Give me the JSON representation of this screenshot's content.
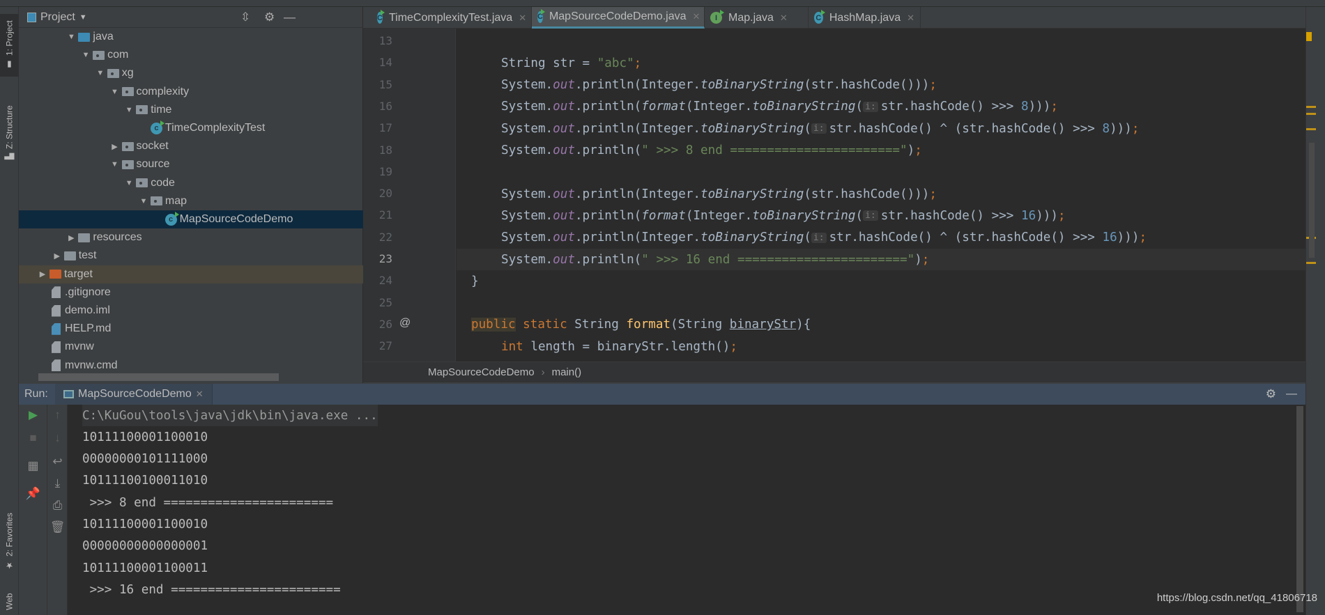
{
  "left_strip": {
    "project": "1: Project",
    "structure": "Z: Structure",
    "favorites": "2: Favorites",
    "web": "Web"
  },
  "project_panel": {
    "title": "Project",
    "tree": [
      {
        "label": "java",
        "level": 2,
        "expanded": true,
        "icon": "source-folder"
      },
      {
        "label": "com",
        "level": 3,
        "expanded": true,
        "icon": "package"
      },
      {
        "label": "xg",
        "level": 4,
        "expanded": true,
        "icon": "package"
      },
      {
        "label": "complexity",
        "level": 5,
        "expanded": true,
        "icon": "package"
      },
      {
        "label": "time",
        "level": 6,
        "expanded": true,
        "icon": "package"
      },
      {
        "label": "TimeComplexityTest",
        "level": 7,
        "icon": "java-class"
      },
      {
        "label": "socket",
        "level": 5,
        "expanded": false,
        "icon": "package"
      },
      {
        "label": "source",
        "level": 5,
        "expanded": true,
        "icon": "package"
      },
      {
        "label": "code",
        "level": 6,
        "expanded": true,
        "icon": "package"
      },
      {
        "label": "map",
        "level": 7,
        "expanded": true,
        "icon": "package"
      },
      {
        "label": "MapSourceCodeDemo",
        "level": 8,
        "icon": "java-class",
        "selected": true
      },
      {
        "label": "resources",
        "level": 2,
        "expanded": false,
        "icon": "resources-folder"
      },
      {
        "label": "test",
        "level": 1,
        "expanded": false,
        "icon": "folder"
      },
      {
        "label": "target",
        "level": 0,
        "expanded": false,
        "icon": "excluded-folder",
        "highlight": true
      },
      {
        "label": ".gitignore",
        "level": 0,
        "icon": "file"
      },
      {
        "label": "demo.iml",
        "level": 0,
        "icon": "file"
      },
      {
        "label": "HELP.md",
        "level": 0,
        "icon": "markdown-file"
      },
      {
        "label": "mvnw",
        "level": 0,
        "icon": "file"
      },
      {
        "label": "mvnw.cmd",
        "level": 0,
        "icon": "file"
      }
    ]
  },
  "editor": {
    "tabs": [
      {
        "label": "TimeComplexityTest.java",
        "icon": "C",
        "active": false
      },
      {
        "label": "MapSourceCodeDemo.java",
        "icon": "C",
        "active": true
      },
      {
        "label": "Map.java",
        "icon": "I",
        "active": false
      },
      {
        "label": "HashMap.java",
        "icon": "C",
        "active": false
      }
    ],
    "current_line": 23,
    "lines": [
      {
        "n": 13,
        "indent": 0,
        "tokens": []
      },
      {
        "n": 14,
        "indent": 2,
        "tokens": [
          [
            "String str = ",
            ""
          ],
          [
            "\"abc\"",
            "str"
          ],
          [
            ";",
            "semi"
          ]
        ]
      },
      {
        "n": 15,
        "indent": 2,
        "tokens": [
          [
            "System.",
            ""
          ],
          [
            "out",
            "field"
          ],
          [
            ".println(Integer.",
            ""
          ],
          [
            "toBinaryString",
            "static"
          ],
          [
            "(str.hashCode()))",
            ""
          ],
          [
            ";",
            "semi"
          ]
        ]
      },
      {
        "n": 16,
        "indent": 2,
        "tokens": [
          [
            "System.",
            ""
          ],
          [
            "out",
            "field"
          ],
          [
            ".println(",
            ""
          ],
          [
            "format",
            "static"
          ],
          [
            "(Integer.",
            ""
          ],
          [
            "toBinaryString",
            "static"
          ],
          [
            "(",
            ""
          ],
          [
            "i:",
            "hint"
          ],
          [
            "str.hashCode() >>> ",
            ""
          ],
          [
            "8",
            "num"
          ],
          [
            ")))",
            ""
          ],
          [
            ";",
            "semi"
          ]
        ]
      },
      {
        "n": 17,
        "indent": 2,
        "tokens": [
          [
            "System.",
            ""
          ],
          [
            "out",
            "field"
          ],
          [
            ".println(Integer.",
            ""
          ],
          [
            "toBinaryString",
            "static"
          ],
          [
            "(",
            ""
          ],
          [
            "i:",
            "hint"
          ],
          [
            "str.hashCode() ^ (str.hashCode() >>> ",
            ""
          ],
          [
            "8",
            "num"
          ],
          [
            ")))",
            ""
          ],
          [
            ";",
            "semi"
          ]
        ]
      },
      {
        "n": 18,
        "indent": 2,
        "tokens": [
          [
            "System.",
            ""
          ],
          [
            "out",
            "field"
          ],
          [
            ".println(",
            ""
          ],
          [
            "\" >>> 8 end =======================\"",
            "str"
          ],
          [
            ")",
            ""
          ],
          [
            ";",
            "semi"
          ]
        ]
      },
      {
        "n": 19,
        "indent": 0,
        "tokens": []
      },
      {
        "n": 20,
        "indent": 2,
        "tokens": [
          [
            "System.",
            ""
          ],
          [
            "out",
            "field"
          ],
          [
            ".println(Integer.",
            ""
          ],
          [
            "toBinaryString",
            "static"
          ],
          [
            "(str.hashCode()))",
            ""
          ],
          [
            ";",
            "semi"
          ]
        ]
      },
      {
        "n": 21,
        "indent": 2,
        "tokens": [
          [
            "System.",
            ""
          ],
          [
            "out",
            "field"
          ],
          [
            ".println(",
            ""
          ],
          [
            "format",
            "static"
          ],
          [
            "(Integer.",
            ""
          ],
          [
            "toBinaryString",
            "static"
          ],
          [
            "(",
            ""
          ],
          [
            "i:",
            "hint"
          ],
          [
            "str.hashCode() >>> ",
            ""
          ],
          [
            "16",
            "num"
          ],
          [
            ")))",
            ""
          ],
          [
            ";",
            "semi"
          ]
        ]
      },
      {
        "n": 22,
        "indent": 2,
        "tokens": [
          [
            "System.",
            ""
          ],
          [
            "out",
            "field"
          ],
          [
            ".println(Integer.",
            ""
          ],
          [
            "toBinaryString",
            "static"
          ],
          [
            "(",
            ""
          ],
          [
            "i:",
            "hint"
          ],
          [
            "str.hashCode() ^ (str.hashCode() >>> ",
            ""
          ],
          [
            "16",
            "num"
          ],
          [
            ")))",
            ""
          ],
          [
            ";",
            "semi"
          ]
        ]
      },
      {
        "n": 23,
        "indent": 2,
        "tokens": [
          [
            "System.",
            ""
          ],
          [
            "out",
            "field"
          ],
          [
            ".println(",
            ""
          ],
          [
            "\" >>> 16 end =======================\"",
            "str"
          ],
          [
            ")",
            ""
          ],
          [
            ";",
            "semi"
          ]
        ]
      },
      {
        "n": 24,
        "indent": 1,
        "tokens": [
          [
            "}",
            ""
          ]
        ]
      },
      {
        "n": 25,
        "indent": 0,
        "tokens": []
      },
      {
        "n": 26,
        "indent": 1,
        "marker": "@",
        "tokens": [
          [
            "public",
            "kwhl"
          ],
          [
            " ",
            ""
          ],
          [
            "static",
            "kw"
          ],
          [
            " String ",
            ""
          ],
          [
            "format",
            "decl"
          ],
          [
            "(String ",
            ""
          ],
          [
            "binaryStr",
            "under"
          ],
          [
            "){",
            ""
          ]
        ]
      },
      {
        "n": 27,
        "indent": 2,
        "tokens": [
          [
            "int",
            "kw"
          ],
          [
            " length = binaryStr.length()",
            ""
          ],
          [
            ";",
            "semi"
          ]
        ]
      }
    ],
    "breadcrumb": [
      "MapSourceCodeDemo",
      "main()"
    ],
    "breadcrumb_sep": "›"
  },
  "run_panel": {
    "label": "Run:",
    "tab": "MapSourceCodeDemo",
    "console": [
      "C:\\KuGou\\tools\\java\\jdk\\bin\\java.exe ...",
      "10111100001100010",
      "00000000101111000",
      "10111100100011010",
      " >>> 8 end =======================",
      "10111100001100010",
      "00000000000000001",
      "10111100001100011",
      " >>> 16 end ======================="
    ]
  },
  "watermark": "https://blog.csdn.net/qq_41806718",
  "colors": {
    "editor_bg": "#2b2b2b",
    "panel_bg": "#3c3f41",
    "selection": "#0d293e",
    "keyword": "#cc7832",
    "string": "#6a8759",
    "number": "#6897bb",
    "field": "#9876aa",
    "run_green": "#499c54"
  }
}
